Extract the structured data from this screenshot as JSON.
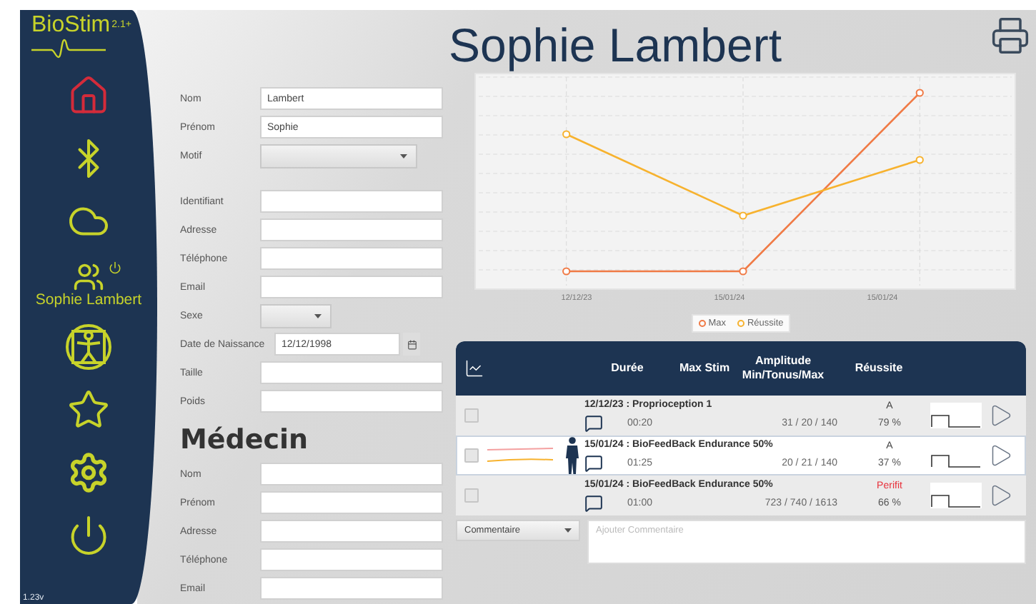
{
  "logo": {
    "name": "BioStim",
    "version": "2.1+"
  },
  "sidebar": {
    "items": [
      {
        "kind": "home",
        "selected": true
      },
      {
        "kind": "bluetooth",
        "selected": false
      },
      {
        "kind": "cloud",
        "selected": false
      },
      {
        "kind": "patient",
        "label": "Sophie Lambert",
        "selected": false
      },
      {
        "kind": "body",
        "selected": false
      },
      {
        "kind": "star",
        "selected": false
      },
      {
        "kind": "settings",
        "selected": false
      },
      {
        "kind": "power",
        "selected": false
      }
    ],
    "version": "1.23v"
  },
  "title": "Sophie Lambert",
  "patient_form": {
    "identity": [
      {
        "label": "Nom",
        "kind": "text",
        "value": "Lambert"
      },
      {
        "label": "Prénom",
        "kind": "text",
        "value": "Sophie"
      },
      {
        "label": "Motif",
        "kind": "select"
      }
    ],
    "details": [
      {
        "label": "Identifiant",
        "kind": "text"
      },
      {
        "label": "Adresse",
        "kind": "text"
      },
      {
        "label": "Téléphone",
        "kind": "text"
      },
      {
        "label": "Email",
        "kind": "text"
      },
      {
        "label": "Sexe",
        "kind": "short_select"
      },
      {
        "label": "Date de Naissance",
        "kind": "date",
        "value": "12/12/1998"
      },
      {
        "label": "Taille",
        "kind": "text"
      },
      {
        "label": "Poids",
        "kind": "text"
      }
    ]
  },
  "doctor": {
    "heading": "Médecin",
    "fields": [
      {
        "label": "Nom",
        "kind": "text"
      },
      {
        "label": "Prénom",
        "kind": "text"
      },
      {
        "label": "Adresse",
        "kind": "text"
      },
      {
        "label": "Téléphone",
        "kind": "text"
      },
      {
        "label": "Email",
        "kind": "text"
      }
    ]
  },
  "chart": {
    "x_labels": [
      "12/12/23",
      "15/01/24",
      "15/01/24"
    ],
    "legend": [
      {
        "label": "Max",
        "color": "#f07a45"
      },
      {
        "label": "Réussite",
        "color": "#f7b22e"
      }
    ]
  },
  "sessions": {
    "columns": [
      "Durée",
      "Max Stim",
      "Amplitude Min/Tonus/Max",
      "Réussite"
    ],
    "rows": [
      {
        "title": "12/12/23 : Proprioception 1",
        "duration": "00:20",
        "amplitude": "31 / 20 / 140",
        "grade": "A",
        "grade_alert": false,
        "success": "79 %",
        "checked": false,
        "selected": false
      },
      {
        "title": "15/01/24 : BioFeedBack Endurance 50%",
        "duration": "01:25",
        "amplitude": "20 / 21 / 140",
        "grade": "A",
        "grade_alert": false,
        "success": "37 %",
        "checked": false,
        "selected": true
      },
      {
        "title": "15/01/24 : BioFeedBack Endurance 50%",
        "duration": "01:00",
        "amplitude": "723 / 740 / 1613",
        "grade": "Perifit",
        "grade_alert": true,
        "success": "66 %",
        "checked": false,
        "selected": false
      }
    ]
  },
  "comment": {
    "type_value": "Commentaire",
    "placeholder": "Ajouter Commentaire"
  }
}
